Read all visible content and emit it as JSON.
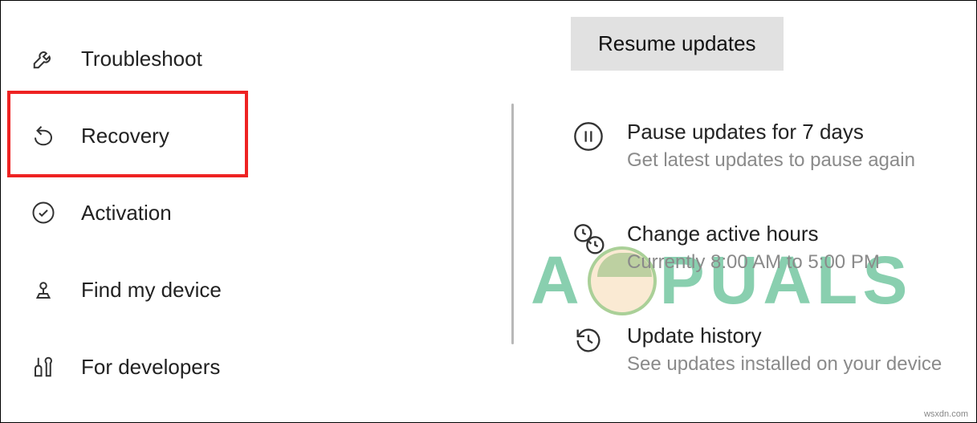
{
  "sidebar": {
    "items": [
      {
        "label": "Troubleshoot"
      },
      {
        "label": "Recovery"
      },
      {
        "label": "Activation"
      },
      {
        "label": "Find my device"
      },
      {
        "label": "For developers"
      }
    ]
  },
  "main": {
    "resume_label": "Resume updates",
    "options": [
      {
        "title": "Pause updates for 7 days",
        "sub": "Get latest updates to pause again"
      },
      {
        "title": "Change active hours",
        "sub": "Currently 8:00 AM to 5:00 PM"
      },
      {
        "title": "Update history",
        "sub": "See updates installed on your device"
      }
    ]
  },
  "watermark": {
    "text_before": "A",
    "text_after": "PUALS"
  },
  "credit": "wsxdn.com"
}
